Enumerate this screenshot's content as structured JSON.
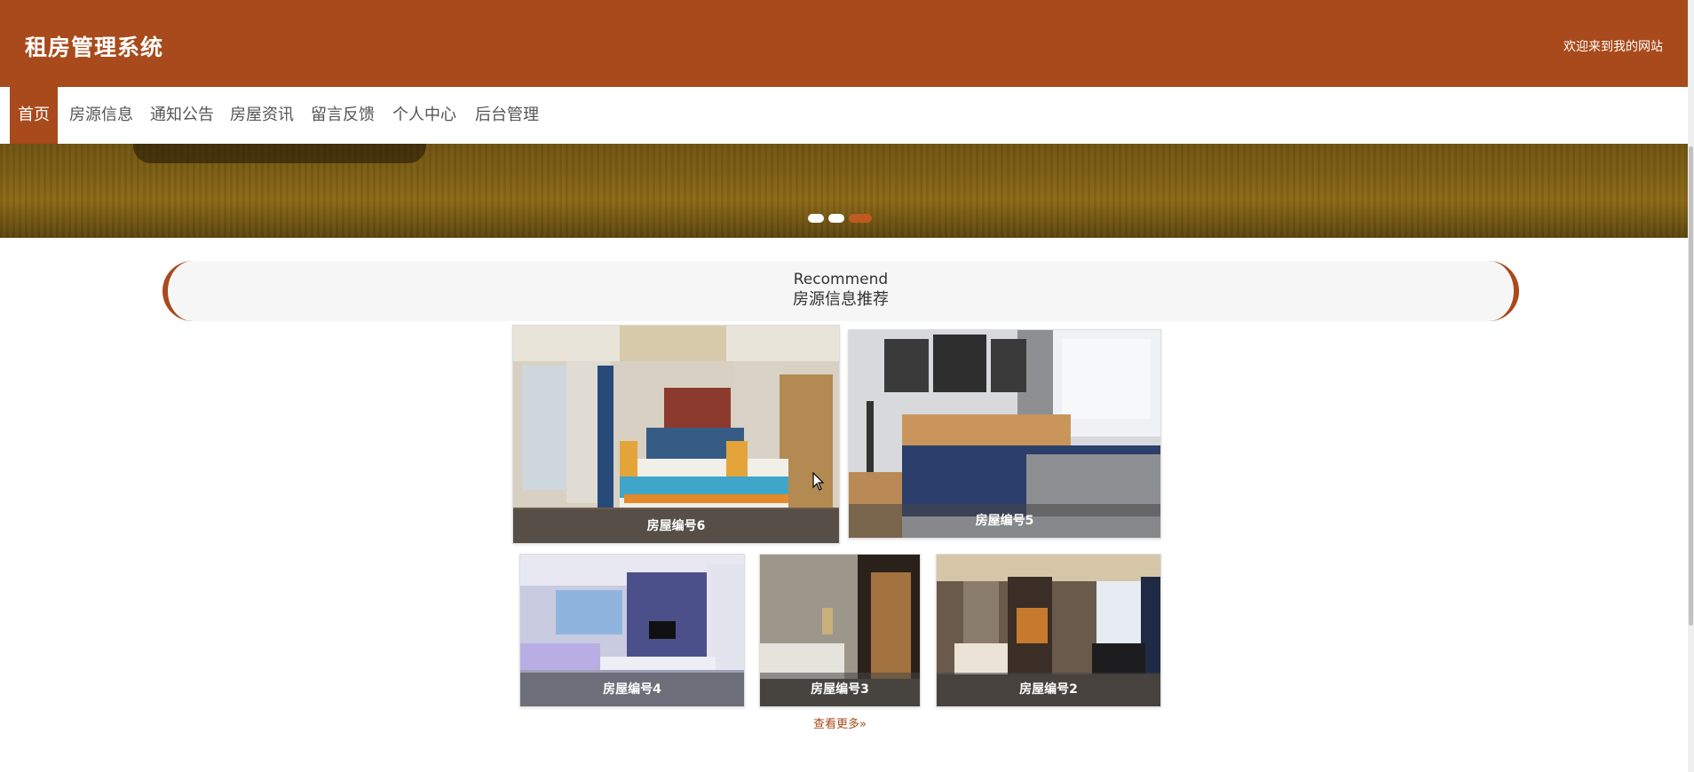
{
  "header": {
    "title": "租房管理系统",
    "welcome": "欢迎来到我的网站",
    "accent_color": "#a84a1b"
  },
  "nav": {
    "items": [
      {
        "label": "首页",
        "active": true
      },
      {
        "label": "房源信息"
      },
      {
        "label": "通知公告"
      },
      {
        "label": "房屋资讯"
      },
      {
        "label": "留言反馈"
      },
      {
        "label": "个人中心"
      },
      {
        "label": "后台管理"
      }
    ]
  },
  "carousel": {
    "slide_count": 3,
    "active_index": 2
  },
  "recommend": {
    "title_en": "Recommend",
    "title_cn": "房源信息推荐",
    "items": [
      {
        "caption": "房屋编号6"
      },
      {
        "caption": "房屋编号5"
      },
      {
        "caption": "房屋编号4"
      },
      {
        "caption": "房屋编号3"
      },
      {
        "caption": "房屋编号2"
      }
    ],
    "more_label": "查看更多»"
  }
}
